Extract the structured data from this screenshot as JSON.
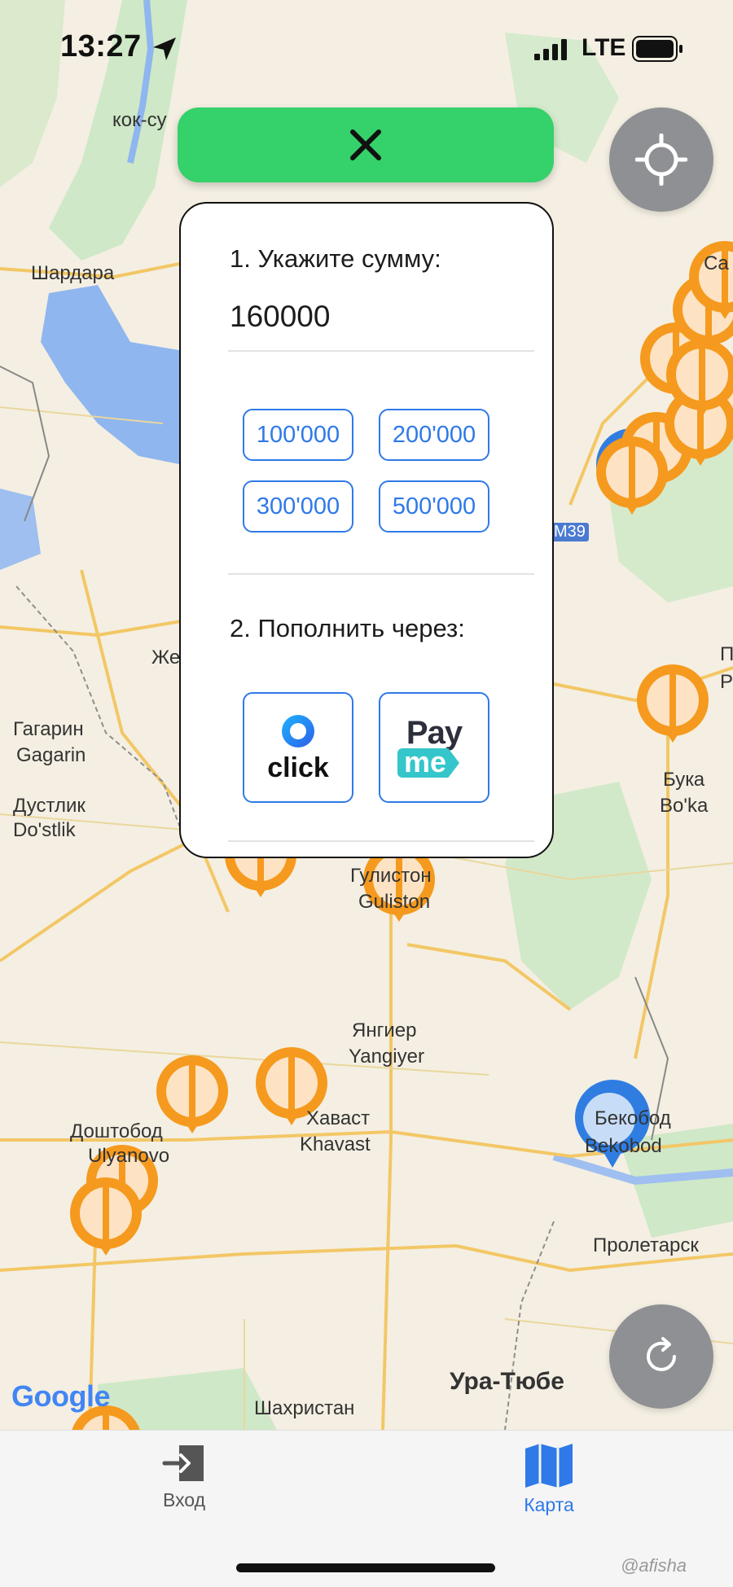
{
  "status_bar": {
    "time": "13:27",
    "network": "LTE"
  },
  "map": {
    "places": [
      "кок-су",
      "Шардара",
      "Жет",
      "Гагарин",
      "Gagarin",
      "Дустлик",
      "Do'stlik",
      "Букa",
      "Bo'ka",
      "Гулистон",
      "Guliston",
      "Янгиер",
      "Yangiyer",
      "Доштобод",
      "Ulyanovo",
      "Хаваст",
      "Khavast",
      "Пролетарск",
      "Ура-Тюбе",
      "Шахристан",
      "Бекобод",
      "Bekobod",
      "M39",
      "Ca",
      "П",
      "P"
    ],
    "attribution": "Google"
  },
  "panel": {
    "step1_label": "1. Укажите сумму:",
    "amount_value": "160000",
    "presets": [
      "100'000",
      "200'000",
      "300'000",
      "500'000"
    ],
    "step2_label": "2. Пополнить через:",
    "providers": {
      "click_label": "click",
      "payme_pay": "Pay",
      "payme_me": "me"
    }
  },
  "tabs": [
    {
      "label": "Вход",
      "active": false
    },
    {
      "label": "Карта",
      "active": true
    }
  ],
  "colors": {
    "accent": "#2f79e8",
    "close_button": "#35d16a",
    "pin_orange": "#f59a1e",
    "pin_blue": "#2f7de1"
  },
  "watermark": "@afisha"
}
